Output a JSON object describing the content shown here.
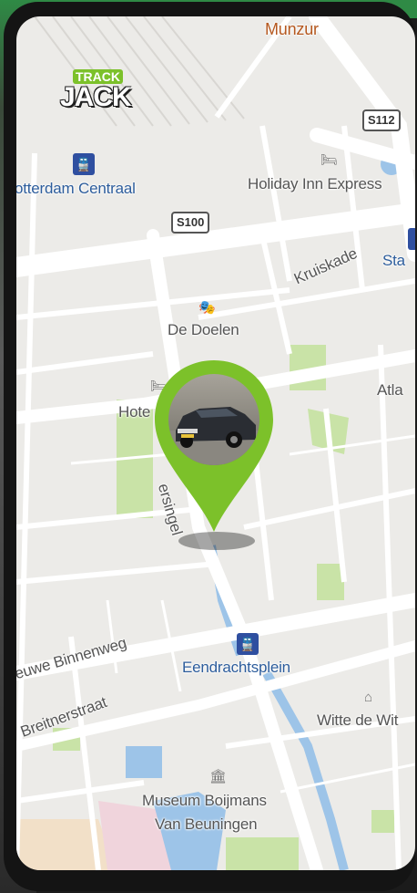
{
  "app": {
    "logo_top": "TRACK",
    "logo_main": "JACK"
  },
  "map": {
    "labels": {
      "munzur": "Munzur",
      "rotterdam_centraal": "otterdam Centraal",
      "holiday_inn": "Holiday Inn Express",
      "kruiskade": "Kruiskade",
      "sta": "Sta",
      "de_doelen": "De Doelen",
      "atla": "Atla",
      "hote": "Hote",
      "singel": "ersingel",
      "nieuwe_binnenweg": "euwe Binnenweg",
      "breitnerstraat": "Breitnerstraat",
      "eendrachtsplein": "Eendrachtsplein",
      "witte_de_with": "Witte de Wit",
      "museum_line1": "Museum Boijmans",
      "museum_line2": "Van Beuningen"
    },
    "route_shields": {
      "s112": "S112",
      "s100": "S100"
    }
  },
  "colors": {
    "accent": "#7cc12a",
    "water": "#9dc4e8",
    "park": "#c9e3a7",
    "road": "#ffffff",
    "map_bg": "#ecebe8"
  },
  "icons": {
    "station": "train-station-icon",
    "hotel": "hotel-icon",
    "theater": "theater-icon",
    "museum": "museum-icon",
    "pin": "location-pin-icon"
  }
}
